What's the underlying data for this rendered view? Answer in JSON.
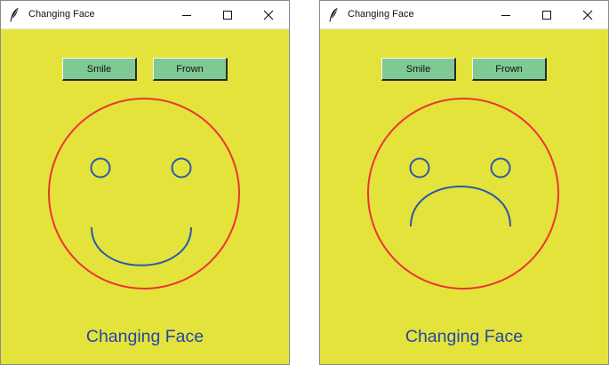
{
  "colors": {
    "canvas_background": "#e3e33c",
    "button_background": "#7fca93",
    "face_outline": "#ee3333",
    "feature_stroke": "#2a5aa6",
    "caption_text": "#2446a6"
  },
  "windows": [
    {
      "title": "Changing Face",
      "icon": "feather-icon",
      "controls": [
        "minimize-icon",
        "maximize-icon",
        "close-icon"
      ],
      "buttons": {
        "smile": "Smile",
        "frown": "Frown"
      },
      "expression": "smile",
      "caption": "Changing Face"
    },
    {
      "title": "Changing Face",
      "icon": "feather-icon",
      "controls": [
        "minimize-icon",
        "maximize-icon",
        "close-icon"
      ],
      "buttons": {
        "smile": "Smile",
        "frown": "Frown"
      },
      "expression": "frown",
      "caption": "Changing Face"
    }
  ]
}
